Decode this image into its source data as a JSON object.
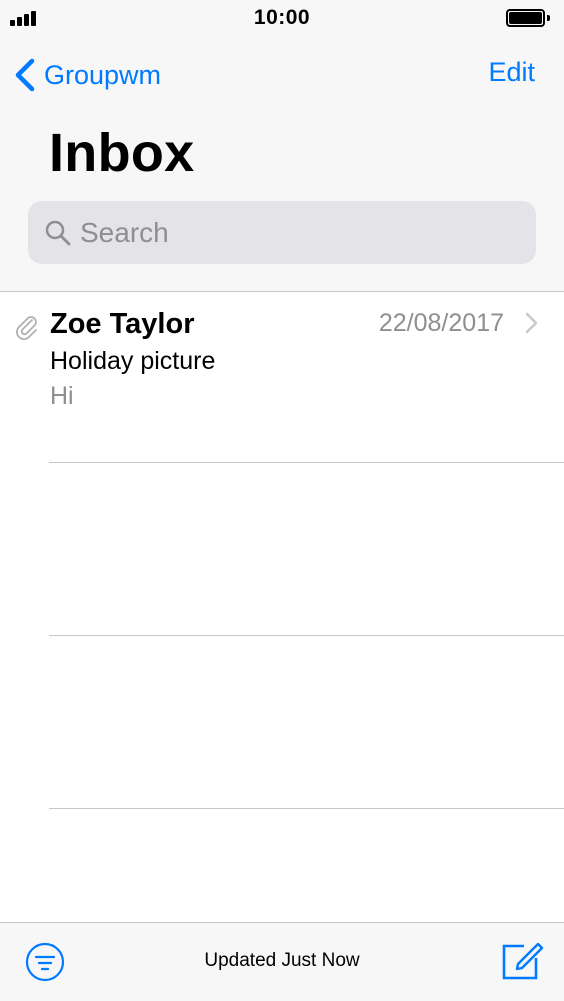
{
  "status_bar": {
    "time": "10:00",
    "signal_icon": "signal-bars-icon",
    "battery_icon": "battery-full-icon"
  },
  "nav": {
    "back_label": "Groupwm",
    "back_icon": "chevron-left-icon",
    "edit_label": "Edit",
    "title": "Inbox"
  },
  "search": {
    "placeholder": "Search",
    "icon": "search-icon"
  },
  "messages": [
    {
      "sender": "Zoe Taylor",
      "date": "22/08/2017",
      "subject": "Holiday picture",
      "preview": "Hi",
      "has_attachment": true
    }
  ],
  "toolbar": {
    "status": "Updated Just Now",
    "filter_icon": "filter-icon",
    "compose_icon": "compose-icon"
  },
  "colors": {
    "accent": "#007aff",
    "secondary_text": "#8e8e93",
    "bar_background": "#f7f7f7",
    "search_background": "#e3e3e8",
    "separator": "#c8c7cc"
  }
}
